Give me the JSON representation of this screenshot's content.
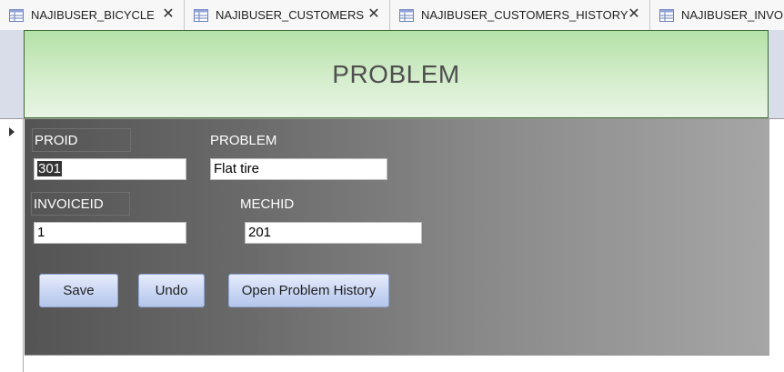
{
  "tabs": [
    {
      "label": "NAJIBUSER_BICYCLE"
    },
    {
      "label": "NAJIBUSER_CUSTOMERS"
    },
    {
      "label": "NAJIBUSER_CUSTOMERS_HISTORY"
    },
    {
      "label": "NAJIBUSER_INVOIC"
    }
  ],
  "tab_close_glyph": "✕",
  "header": {
    "title": "PROBLEM"
  },
  "form": {
    "proid": {
      "label": "PROID",
      "value": "301"
    },
    "problem": {
      "label": "PROBLEM",
      "value": "Flat tire"
    },
    "invoiceid": {
      "label": "INVOICEID",
      "value": "1"
    },
    "mechid": {
      "label": "MECHID",
      "value": "201"
    }
  },
  "buttons": {
    "save": "Save",
    "undo": "Undo",
    "open_history": "Open Problem History"
  },
  "colors": {
    "header_gradient_top": "#b4e1a6",
    "detail_gradient_left": "#545454",
    "detail_gradient_right": "#a6a6a6",
    "button_blue": "#c9d6f3"
  }
}
